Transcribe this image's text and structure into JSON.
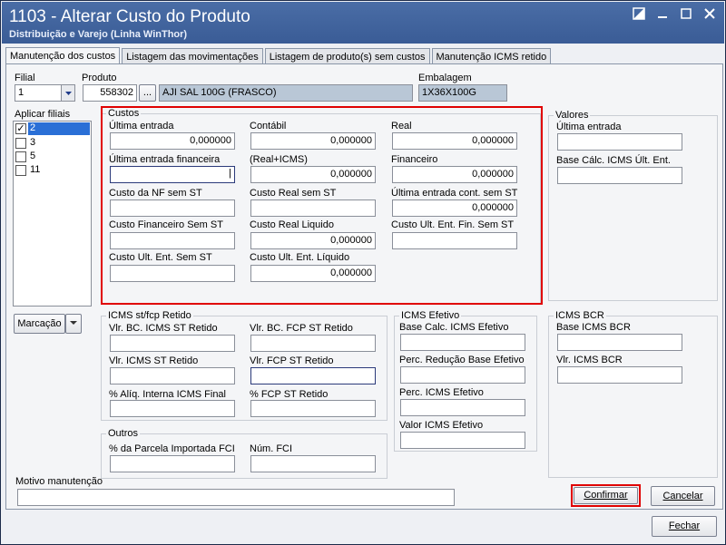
{
  "window": {
    "title": "1103 - Alterar Custo do Produto",
    "subtitle": "Distribuição e Varejo (Linha WinThor)",
    "controls": [
      "restore",
      "minimize",
      "maximize",
      "close"
    ]
  },
  "tabs": [
    {
      "label": "Manutenção dos custos",
      "active": true
    },
    {
      "label": "Listagem das movimentações",
      "active": false
    },
    {
      "label": "Listagem de produto(s)  sem custos",
      "active": false
    },
    {
      "label": "Manutenção ICMS retido",
      "active": false
    }
  ],
  "header": {
    "filial_label": "Filial",
    "filial_value": "1",
    "produto_label": "Produto",
    "produto_code": "558302",
    "produto_browse": "...",
    "produto_desc": "AJI SAL 100G (FRASCO)",
    "embalagem_label": "Embalagem",
    "embalagem_value": "1X36X100G"
  },
  "filiais": {
    "label": "Aplicar filiais",
    "items": [
      {
        "label": "2",
        "checked": true,
        "selected": true
      },
      {
        "label": "3",
        "checked": false,
        "selected": false
      },
      {
        "label": "5",
        "checked": false,
        "selected": false
      },
      {
        "label": "11",
        "checked": false,
        "selected": false
      }
    ],
    "marcacao_label": "Marcação"
  },
  "custos": {
    "title": "Custos",
    "ultima_entrada": {
      "label": "Última entrada",
      "value": "0,000000"
    },
    "contabil": {
      "label": "Contábil",
      "value": "0,000000"
    },
    "real": {
      "label": "Real",
      "value": "0,000000"
    },
    "ultima_entrada_fin": {
      "label": "Última entrada financeira",
      "value": ""
    },
    "real_icms": {
      "label": "(Real+ICMS)",
      "value": "0,000000"
    },
    "financeiro": {
      "label": "Financeiro",
      "value": "0,000000"
    },
    "custo_nf_sem_st": {
      "label": "Custo da NF sem ST",
      "value": ""
    },
    "custo_real_sem_st": {
      "label": "Custo Real sem ST",
      "value": ""
    },
    "ult_entrada_cont_sem_st": {
      "label": "Última entrada cont. sem ST",
      "value": "0,000000"
    },
    "custo_fin_sem_st": {
      "label": "Custo Financeiro Sem ST",
      "value": ""
    },
    "custo_real_liquido": {
      "label": "Custo Real Liquido",
      "value": "0,000000"
    },
    "custo_ult_ent_fin_sem_st": {
      "label": "Custo Ult. Ent. Fin. Sem ST",
      "value": ""
    },
    "custo_ult_ent_sem_st": {
      "label": "Custo Ult. Ent. Sem ST",
      "value": ""
    },
    "custo_ult_ent_liquido": {
      "label": "Custo Ult. Ent. Líquido",
      "value": "0,000000"
    }
  },
  "valores": {
    "title": "Valores",
    "ultima_entrada": {
      "label": "Última entrada",
      "value": ""
    },
    "base_calc_icms": {
      "label": "Base Cálc. ICMS Últ. Ent.",
      "value": ""
    }
  },
  "icms_st": {
    "title": "ICMS st/fcp Retido",
    "vlr_bc_icms_st": {
      "label": "Vlr. BC. ICMS ST Retido",
      "value": ""
    },
    "vlr_bc_fcp_st": {
      "label": "Vlr. BC. FCP ST Retido",
      "value": ""
    },
    "vlr_icms_st": {
      "label": "Vlr. ICMS ST Retido",
      "value": ""
    },
    "vlr_fcp_st": {
      "label": "Vlr. FCP ST Retido",
      "value": ""
    },
    "aliq_interna": {
      "label": "% Alíq. Interna ICMS Final",
      "value": ""
    },
    "fcp_st": {
      "label": "% FCP ST Retido",
      "value": ""
    }
  },
  "icms_efetivo": {
    "title": "ICMS Efetivo",
    "base_calc": {
      "label": "Base Calc. ICMS Efetivo",
      "value": ""
    },
    "perc_reducao": {
      "label": "Perc. Redução Base Efetivo",
      "value": ""
    },
    "perc_icms": {
      "label": "Perc. ICMS Efetivo",
      "value": ""
    },
    "valor_icms": {
      "label": "Valor ICMS Efetivo",
      "value": ""
    }
  },
  "icms_bcr": {
    "title": "ICMS BCR",
    "base": {
      "label": "Base ICMS BCR",
      "value": ""
    },
    "vlr": {
      "label": "Vlr. ICMS BCR",
      "value": ""
    }
  },
  "outros": {
    "title": "Outros",
    "parcela_importada": {
      "label": "% da Parcela Importada FCI",
      "value": ""
    },
    "num_fci": {
      "label": "Núm. FCI",
      "value": ""
    }
  },
  "motivo": {
    "label": "Motivo manutenção",
    "value": ""
  },
  "buttons": {
    "confirmar": "Confirmar",
    "cancelar": "Cancelar",
    "fechar": "Fechar"
  },
  "colors": {
    "titlebar": "#3f6199",
    "highlight": "#e00000",
    "readonly_field": "#b9c7d6"
  }
}
